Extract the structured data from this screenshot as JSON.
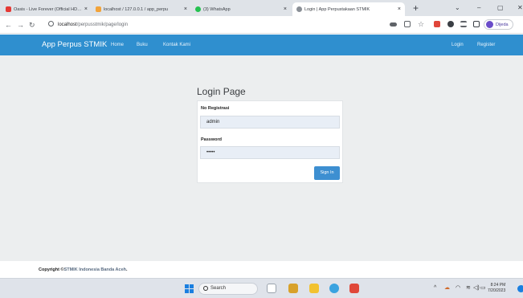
{
  "browser": {
    "tabs": [
      {
        "title": "Oasis - Live Forever (Official HD Re",
        "favicon_color": "#e53935"
      },
      {
        "title": "localhost / 127.0.0.1 / app_perpu",
        "favicon_color": "#f2a33a"
      },
      {
        "title": "(3) WhatsApp",
        "favicon_color": "#25c150"
      },
      {
        "title": "Login | App Perpustakaan STMIK",
        "favicon_color": "#5f6368"
      }
    ],
    "tab_close_glyph": "×",
    "new_tab_glyph": "+",
    "window_controls": [
      "⌄",
      "–",
      "▢",
      "✕"
    ],
    "url_host": "localhost",
    "url_path": "/perpusstmik/page/login",
    "profile_label": "Dijeda",
    "nav_icons": [
      "back-icon",
      "forward-icon",
      "reload-icon"
    ],
    "nav_glyphs": [
      "←",
      "→",
      "↻"
    ]
  },
  "app": {
    "brand": "App Perpus STMIK",
    "nav_left": [
      "Home",
      "Buku",
      "Kontak Kami"
    ],
    "nav_right": [
      "Login",
      "Register"
    ],
    "navbar_color": "#2f8fcf"
  },
  "login": {
    "title": "Login Page",
    "username_label": "No Registrasi",
    "username_value": "admin",
    "password_label": "Password",
    "password_value": "•••••",
    "submit_label": "Sign In"
  },
  "footer": {
    "prefix": "Copyright ©",
    "org": "STMIK Indonesia Banda Aceh",
    "suffix": "."
  },
  "taskbar": {
    "search_label": "Search",
    "time": "8:24 PM",
    "date": "7/20/2023",
    "tray_glyphs": [
      "^",
      "☁",
      "◠",
      "≋",
      "◁)",
      "▭"
    ]
  }
}
